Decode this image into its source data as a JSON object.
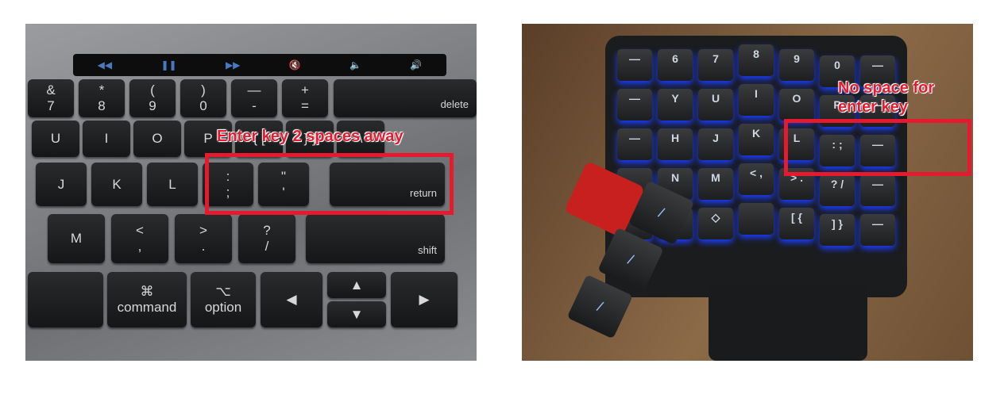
{
  "left_photo": {
    "touchbar": [
      "◀◀",
      "❚❚",
      "▶▶",
      "🔇",
      "🔈",
      "🔊"
    ],
    "keys": {
      "r1": [
        [
          "&",
          "7"
        ],
        [
          "*",
          "8"
        ],
        [
          "(",
          "9"
        ],
        [
          ")",
          "0"
        ],
        [
          "—",
          "-"
        ],
        [
          "+",
          "="
        ]
      ],
      "delete": "delete",
      "r2": [
        "U",
        "I",
        "O",
        "P",
        "{ [",
        "} ]",
        "\\"
      ],
      "r3": [
        "J",
        "K",
        "L",
        [
          ":",
          ";"
        ],
        [
          "\"",
          "'"
        ]
      ],
      "return": "return",
      "r4": [
        "M",
        [
          "<",
          ","
        ],
        [
          ">",
          "."
        ],
        [
          "?",
          "/"
        ]
      ],
      "shift": "shift",
      "command": [
        "⌘",
        "command"
      ],
      "option": [
        "⌥",
        "option"
      ],
      "arrows": [
        "◀",
        "▲",
        "▼",
        "▶"
      ]
    },
    "annotation": "Enter key 2 spaces away",
    "highlight_color": "#e61a2e"
  },
  "right_photo": {
    "rows": [
      [
        "—",
        "6",
        "7",
        "8",
        "9",
        "0",
        "—"
      ],
      [
        "—",
        "Y",
        "U",
        "I",
        "O",
        "P",
        "—"
      ],
      [
        "—",
        "H",
        "J",
        "K",
        "L",
        ":  ;",
        "—"
      ],
      [
        "",
        "N",
        "M",
        "< ,",
        "> .",
        "? /",
        "—"
      ],
      [
        "",
        "◇",
        "◇",
        "",
        "[ {",
        "] }",
        "—"
      ]
    ],
    "thumb_keys": [
      "/",
      "/",
      "/"
    ],
    "annotation_line1": "No space for",
    "annotation_line2": "enter key",
    "highlight_color": "#e61a2e"
  }
}
